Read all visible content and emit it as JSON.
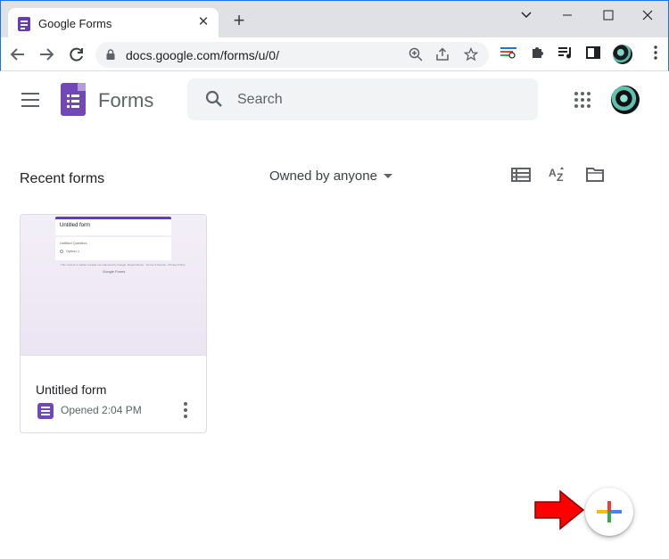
{
  "browser": {
    "tab_title": "Google Forms",
    "tab_close_icon": "close-icon",
    "new_tab_icon": "plus-icon",
    "window_controls": [
      "chevron-down-icon",
      "minimize-icon",
      "maximize-icon",
      "close-icon"
    ],
    "url": "docs.google.com/forms/u/0/",
    "nav_icons": [
      "back-arrow-icon",
      "forward-arrow-icon",
      "reload-icon"
    ],
    "omnibox_icons": [
      "zoom-icon",
      "share-icon",
      "star-icon"
    ],
    "extension_icons": [
      "extension-custom-icon",
      "puzzle-icon",
      "media-queue-icon",
      "sidebar-icon",
      "profile-avatar"
    ]
  },
  "header": {
    "app_name": "Forms",
    "search_placeholder": "Search",
    "apps_icon": "grid-apps-icon",
    "brand_color": "#7248b9"
  },
  "toolbar": {
    "section_title": "Recent forms",
    "owner_filter": "Owned by anyone",
    "view_icons": [
      "list-view-icon",
      "sort-az-icon",
      "folder-icon"
    ]
  },
  "forms": [
    {
      "title": "Untitled form",
      "meta": "Opened 2:04 PM",
      "thumbnail": {
        "title": "Untitled form",
        "question": "Untitled Question",
        "option": "Option 1",
        "footer": "This content is neither created nor endorsed by Google. Report Abuse - Terms of Service - Privacy Policy",
        "brand": "Google Forms"
      }
    }
  ],
  "fab": {
    "icon": "plus-icon",
    "colors": [
      "#ea4335",
      "#4285f4",
      "#34a853",
      "#fbbc04"
    ]
  },
  "annotation": {
    "arrow_color": "#ff0000"
  }
}
